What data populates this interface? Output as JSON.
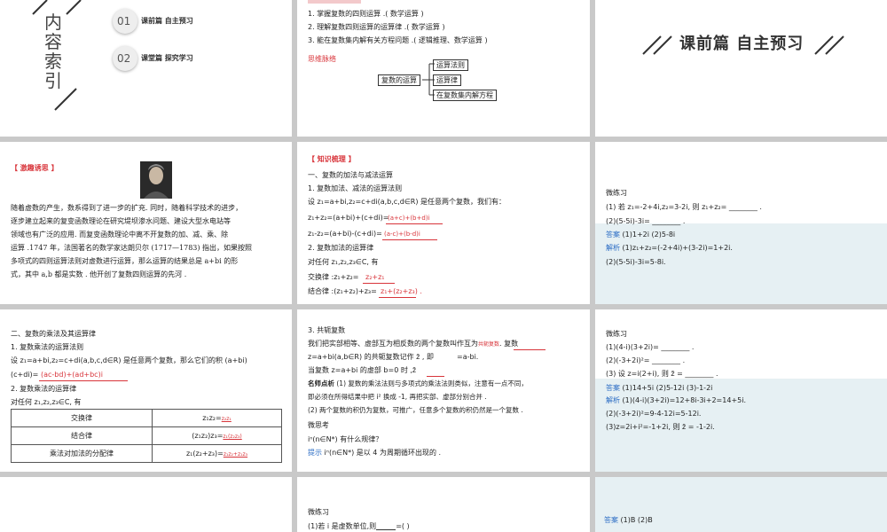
{
  "s1": {
    "title_chars": [
      "内",
      "容",
      "索",
      "引"
    ],
    "items": [
      {
        "num": "01",
        "label": "课前篇  自主预习"
      },
      {
        "num": "02",
        "label": "课堂篇  探究学习"
      }
    ]
  },
  "s2": {
    "goals": [
      "1. 掌握复数的四则运算 .( 数学运算 )",
      "2. 理解复数四则运算的运算律 .( 数学运算 )",
      "3. 能在复数集内解有关方程问题 .( 逻辑推理、数学运算 )"
    ],
    "mind_title": "思维脉络",
    "root": "复数的运算",
    "branches": [
      "运算法则",
      "运算律",
      "在复数集内解方程"
    ]
  },
  "s3": {
    "title": "课前篇  自主预习"
  },
  "s4": {
    "tag": "【 激趣诱思 】",
    "lines": [
      "随着虚数的产生，数系得到了进一步的扩充. 同时，随着科学技术的进步，",
      "逐步建立起来的复变函数理论在研究堤坝渗水问题、建设大型水电站等",
      "领域也有广泛的应用. 而复变函数理论中离不开复数的加、减、乘、除",
      "运算 .1747 年，法国著名的数学家达朗贝尔 (1717—1783) 指出，如果按照",
      "多项式的四则运算法则对虚数进行运算，那么运算的结果总是 a+bi 的形",
      "式，其中 a,b 都是实数 . 他开创了复数四则运算的先河 ."
    ]
  },
  "s5": {
    "tag": "【 知识梳理 】",
    "lines": [
      "一、复数的加法与减法运算",
      "1. 复数加法、减法的运算法则",
      "设 z₁=a+bi,z₂=c+di(a,b,c,d∈R) 是任意两个复数，我们有：",
      "z₁+z₂=(a+bi)+(c+di)=",
      "z₁-z₂=(a+bi)-(c+di)=",
      "2. 复数加法的运算律",
      "对任何 z₁,z₂,z₃∈C, 有",
      "交换律 :z₁+z₂=",
      "结合律 :(z₁+z₂)+z₃="
    ],
    "ans_add": "(a+c)+(b+d)i",
    "ans_sub": "(a-c)+(b-d)i",
    "ans_comm": "z₂+z₁",
    "ans_assoc": "z₁+(z₂+z₃) ."
  },
  "s6": {
    "title": "微练习",
    "q1": "(1) 若 z₁=-2+4i,z₂=3-2i, 则 z₁+z₂=",
    "q2": "(2)(5-5i)-3i=",
    "ans_label": "答案",
    "ans": "(1)1+2i     (2)5-8i",
    "exp_label": "解析",
    "exp1": "(1)z₁+z₂=(-2+4i)+(3-2i)=1+2i.",
    "exp2": "(2)(5-5i)-3i=5-8i."
  },
  "s7": {
    "lines": [
      "二、复数的乘法及其运算律",
      "1. 复数乘法的运算法则",
      "设 z₁=a+bi,z₂=c+di(a,b,c,d∈R) 是任意两个复数，那么它们的积 (a+bi)",
      "(c+di)=",
      "2. 复数乘法的运算律",
      "对任何 z₁,z₂,z₃∈C, 有"
    ],
    "ans_mul": "(ac-bd)+(ad+bc)i",
    "rows": [
      {
        "name": "交换律",
        "formula": "z₁z₂=",
        "ans": "z₂z₁"
      },
      {
        "name": "结合律",
        "formula": "(z₁z₂)z₃=",
        "ans": "z₁(z₂z₃)"
      },
      {
        "name": "乘法对加法的分配律",
        "formula": "z₁(z₂+z₃)=",
        "ans": "z₁z₂+z₁z₃"
      }
    ]
  },
  "s8": {
    "h": "3. 共轭复数",
    "l1": "我们把实部相等、虚部互为相反数的两个复数叫作互为",
    "l1_ans": "共轭复数",
    "l1_tail": ". 复数",
    "l2": "z=a+bi(a,b∈R) 的共轭复数记作 z̄ , 即",
    "l2_tail": "=a-bi.",
    "l3": "当复数 z=a+bi 的虚部 b=0 时 ,z̄",
    "note_label": "名师点析",
    "note1": " (1) 复数的乘法法则与多项式的乘法法则类似，注意有一点不同，",
    "note2": "即必须在所得结果中把 i² 换成 -1, 再把实部、虚部分别合并 .",
    "note3": "(2) 两个复数的积仍为复数，可推广，任意多个复数的积仍然是一个复数 .",
    "think": "微思考",
    "think_q": "iⁿ(n∈N*) 有什么规律？",
    "tip_label": "提示",
    "tip": "iⁿ(n∈N*) 是以 4 为周期循环出现的 ."
  },
  "s9": {
    "title": "微练习",
    "q1": "(1)(4-i)(3+2i)= ________ .",
    "q2": "(2)(-3+2i)²= ________ .",
    "q3": "(3) 设 z=i(2+i), 则 z̄ = ________ .",
    "ans_label": "答案",
    "ans": "(1)14+5i     (2)5-12i     (3)-1-2i",
    "exp_label": "解析",
    "exp1": "(1)(4-i)(3+2i)=12+8i-3i+2=14+5i.",
    "exp2": "(2)(-3+2i)²=9-4-12i=5-12i.",
    "exp3": "(3)z=2i+i²=-1+2i, 则 z̄ = -1-2i."
  },
  "s11": {
    "title": "微练习",
    "q1": "(1)若 i 是虚数单位,则",
    "q1_tail": "=(     )"
  },
  "s12": {
    "ans_label": "答案",
    "ans": "(1)B     (2)B"
  },
  "colors": {
    "accent_red": "#d8343a",
    "accent_blue": "#2b6cc4",
    "tint": "#e6f0f3"
  }
}
